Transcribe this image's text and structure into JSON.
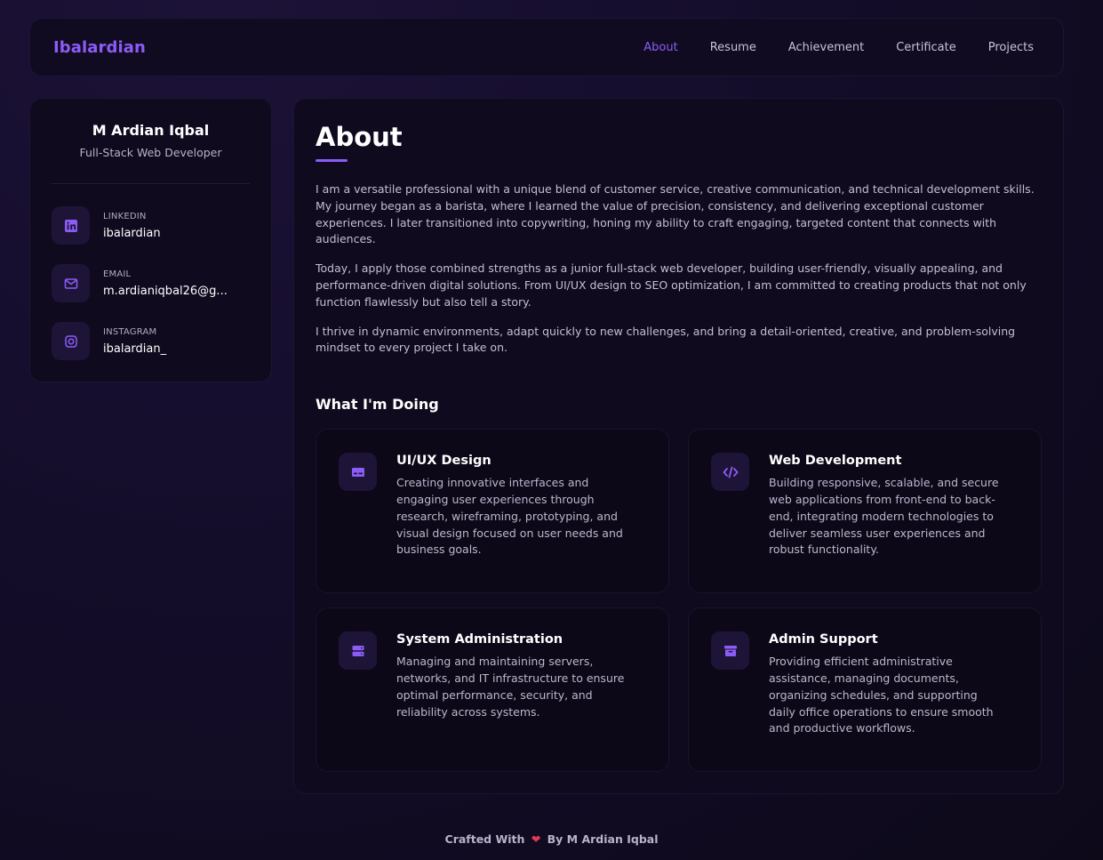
{
  "nav": {
    "brand": "Ibalardian",
    "links": [
      {
        "label": "About",
        "active": true
      },
      {
        "label": "Resume"
      },
      {
        "label": "Achievement"
      },
      {
        "label": "Certificate"
      },
      {
        "label": "Projects"
      }
    ]
  },
  "sidebar": {
    "name": "M Ardian Iqbal",
    "title": "Full-Stack Web Developer",
    "contacts": [
      {
        "label": "LINKEDIN",
        "value": "ibalardian",
        "icon": "linkedin-icon"
      },
      {
        "label": "EMAIL",
        "value": "m.ardianiqbal26@g...",
        "icon": "mail-icon"
      },
      {
        "label": "INSTAGRAM",
        "value": "ibalardian_",
        "icon": "instagram-icon"
      }
    ]
  },
  "main": {
    "title": "About",
    "paragraphs": [
      "I am a versatile professional with a unique blend of customer service, creative communication, and technical development skills. My journey began as a barista, where I learned the value of precision, consistency, and delivering exceptional customer experiences. I later transitioned into copywriting, honing my ability to craft engaging, targeted content that connects with audiences.",
      "Today, I apply those combined strengths as a junior full-stack web developer, building user-friendly, visually appealing, and performance-driven digital solutions. From UI/UX design to SEO optimization, I am committed to creating products that not only function flawlessly but also tell a story.",
      "I thrive in dynamic environments, adapt quickly to new challenges, and bring a detail-oriented, creative, and problem-solving mindset to every project I take on."
    ],
    "section_title": "What I'm Doing",
    "services": [
      {
        "title": "UI/UX Design",
        "icon": "design-icon",
        "desc": "Creating innovative interfaces and engaging user experiences through research, wireframing, prototyping, and visual design focused on user needs and business goals."
      },
      {
        "title": "Web Development",
        "icon": "code-icon",
        "desc": "Building responsive, scalable, and secure web applications from front-end to back-end, integrating modern technologies to deliver seamless user experiences and robust functionality."
      },
      {
        "title": "System Administration",
        "icon": "server-icon",
        "desc": "Managing and maintaining servers, networks, and IT infrastructure to ensure optimal performance, security, and reliability across systems."
      },
      {
        "title": "Admin Support",
        "icon": "archive-icon",
        "desc": "Providing efficient administrative assistance, managing documents, organizing schedules, and supporting daily office operations to ensure smooth and productive workflows."
      }
    ]
  },
  "footer": {
    "prefix": "Crafted With",
    "heart": "❤",
    "suffix": "By M Ardian Iqbal"
  },
  "colors": {
    "accent": "#8b5cf6",
    "heart": "#e53950"
  }
}
